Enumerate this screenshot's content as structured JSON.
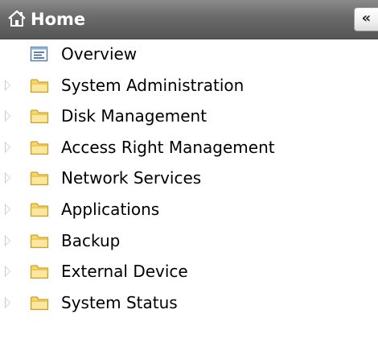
{
  "header": {
    "title": "Home",
    "home_icon": "home-icon",
    "collapse_label": "«",
    "collapse_icon": "double-chevron-left-icon"
  },
  "tree": {
    "items": [
      {
        "label": "Overview",
        "icon": "overview-list-icon",
        "expandable": false
      },
      {
        "label": "System Administration",
        "icon": "folder-icon",
        "expandable": true
      },
      {
        "label": "Disk Management",
        "icon": "folder-icon",
        "expandable": true
      },
      {
        "label": "Access Right Management",
        "icon": "folder-icon",
        "expandable": true
      },
      {
        "label": "Network Services",
        "icon": "folder-icon",
        "expandable": true
      },
      {
        "label": "Applications",
        "icon": "folder-icon",
        "expandable": true
      },
      {
        "label": "Backup",
        "icon": "folder-icon",
        "expandable": true
      },
      {
        "label": "External Device",
        "icon": "folder-icon",
        "expandable": true
      },
      {
        "label": "System Status",
        "icon": "folder-icon",
        "expandable": true
      }
    ]
  },
  "colors": {
    "header_top": "#8a8a8a",
    "header_bottom": "#555555",
    "folder_fill": "#f7d66a",
    "folder_stroke": "#c9a12e"
  }
}
